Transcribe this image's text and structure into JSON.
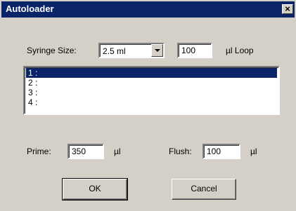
{
  "window": {
    "title": "Autoloader",
    "close_glyph": "×"
  },
  "syringe": {
    "label": "Syringe Size:",
    "size_value": "2.5 ml",
    "loop_value": "100",
    "loop_unit": "µl Loop"
  },
  "list": {
    "items": [
      {
        "label": "1 :",
        "selected": true
      },
      {
        "label": "2 :",
        "selected": false
      },
      {
        "label": "3 :",
        "selected": false
      },
      {
        "label": "4 :",
        "selected": false
      }
    ]
  },
  "prime": {
    "label": "Prime:",
    "value": "350",
    "unit": "µl"
  },
  "flush": {
    "label": "Flush:",
    "value": "100",
    "unit": "µl"
  },
  "buttons": {
    "ok": "OK",
    "cancel": "Cancel"
  },
  "colors": {
    "face": "#d4d0c8",
    "titlebar": "#0a246a",
    "selection": "#0a246a"
  }
}
